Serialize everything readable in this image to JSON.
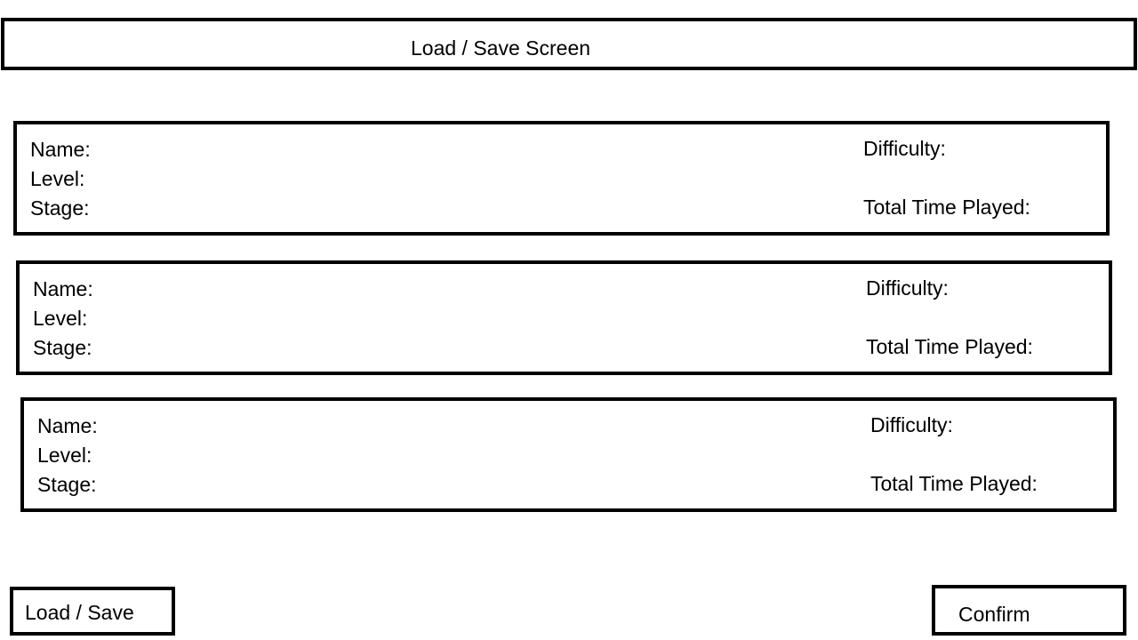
{
  "header": {
    "title": "Load / Save Screen"
  },
  "slots": [
    {
      "name_label": "Name:",
      "level_label": "Level:",
      "stage_label": "Stage:",
      "difficulty_label": "Difficulty:",
      "time_label": "Total Time Played:"
    },
    {
      "name_label": "Name:",
      "level_label": "Level:",
      "stage_label": "Stage:",
      "difficulty_label": "Difficulty:",
      "time_label": "Total Time Played:"
    },
    {
      "name_label": "Name:",
      "level_label": "Level:",
      "stage_label": "Stage:",
      "difficulty_label": "Difficulty:",
      "time_label": "Total Time Played:"
    }
  ],
  "footer": {
    "load_save_label": "Load / Save",
    "confirm_label": "Confirm"
  },
  "colors": {
    "border": "#000000",
    "background": "#ffffff",
    "text": "#000000"
  }
}
